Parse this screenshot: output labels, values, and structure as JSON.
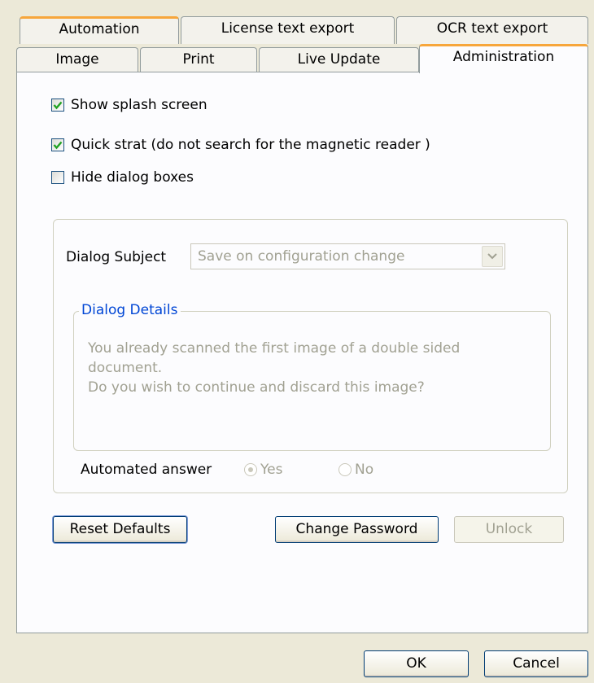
{
  "tabs_row1": [
    {
      "label": "Automation"
    },
    {
      "label": "License text export"
    },
    {
      "label": "OCR text export"
    }
  ],
  "tabs_row2": [
    {
      "label": "Image"
    },
    {
      "label": "Print"
    },
    {
      "label": "Live Update"
    },
    {
      "label": "Administration"
    }
  ],
  "options": {
    "show_splash": {
      "label": "Show splash screen",
      "checked": true
    },
    "quick_start": {
      "label": "Quick strat (do not search for the magnetic reader )",
      "checked": true
    },
    "hide_dialogs": {
      "label": "Hide dialog boxes",
      "checked": false
    }
  },
  "dialog": {
    "subject_label": "Dialog Subject",
    "subject_value": "Save on configuration change",
    "details_legend": "Dialog Details",
    "details_line1": "You already scanned the first image of a double sided",
    "details_line2": "document.",
    "details_line3": "Do you wish to continue and discard this image?",
    "answer_label": "Automated answer",
    "yes_label": "Yes",
    "no_label": "No",
    "selected_answer": "Yes"
  },
  "buttons": {
    "reset": "Reset Defaults",
    "change_password": "Change Password",
    "unlock": "Unlock",
    "ok": "OK",
    "cancel": "Cancel"
  },
  "colors": {
    "tab_highlight": "#f7a63b",
    "checkbox_check": "#21a121",
    "legend_text": "#0046d5",
    "disabled_text": "#a1a192"
  }
}
